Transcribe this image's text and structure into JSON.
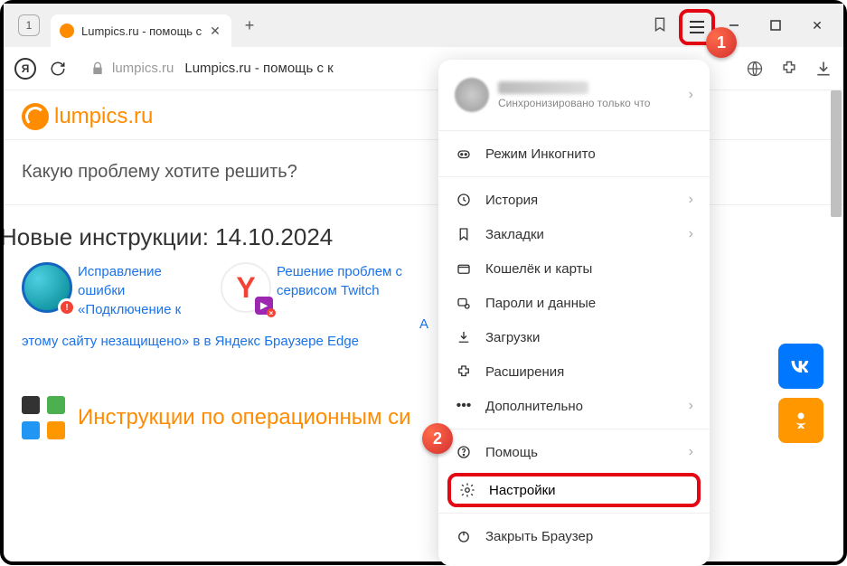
{
  "window": {
    "tabCount": "1",
    "tabTitle": "Lumpics.ru - помощь с"
  },
  "address": {
    "domain": "lumpics.ru",
    "title": "Lumpics.ru - помощь с к"
  },
  "page": {
    "logo": "lumpics.ru",
    "searchPrompt": "Какую проблему хотите решить?",
    "newInstructions": "Новые инструкции: 14.10.2024",
    "cards": [
      {
        "text": "Исправление ошибки «Подключение к",
        "tail": "этому сайту незащищено» в в Яндекс Браузере Edge"
      },
      {
        "text": "Решение проблем с сервисом Twitch"
      }
    ],
    "trailingLetter": "А",
    "osHeading": "Инструкции по операционным си"
  },
  "menu": {
    "profileStatus": "Синхронизировано только что",
    "items1": [
      {
        "icon": "incognito",
        "label": "Режим Инкогнито"
      }
    ],
    "items2": [
      {
        "icon": "history",
        "label": "История",
        "chev": true
      },
      {
        "icon": "bookmark",
        "label": "Закладки",
        "chev": true
      },
      {
        "icon": "wallet",
        "label": "Кошелёк и карты"
      },
      {
        "icon": "passwords",
        "label": "Пароли и данные"
      },
      {
        "icon": "download",
        "label": "Загрузки"
      },
      {
        "icon": "extension",
        "label": "Расширения"
      },
      {
        "icon": "more",
        "label": "Дополнительно",
        "chev": true
      }
    ],
    "help": "Помощь",
    "settings": "Настройки",
    "closeBrowser": "Закрыть Браузер"
  },
  "callouts": {
    "one": "1",
    "two": "2"
  }
}
